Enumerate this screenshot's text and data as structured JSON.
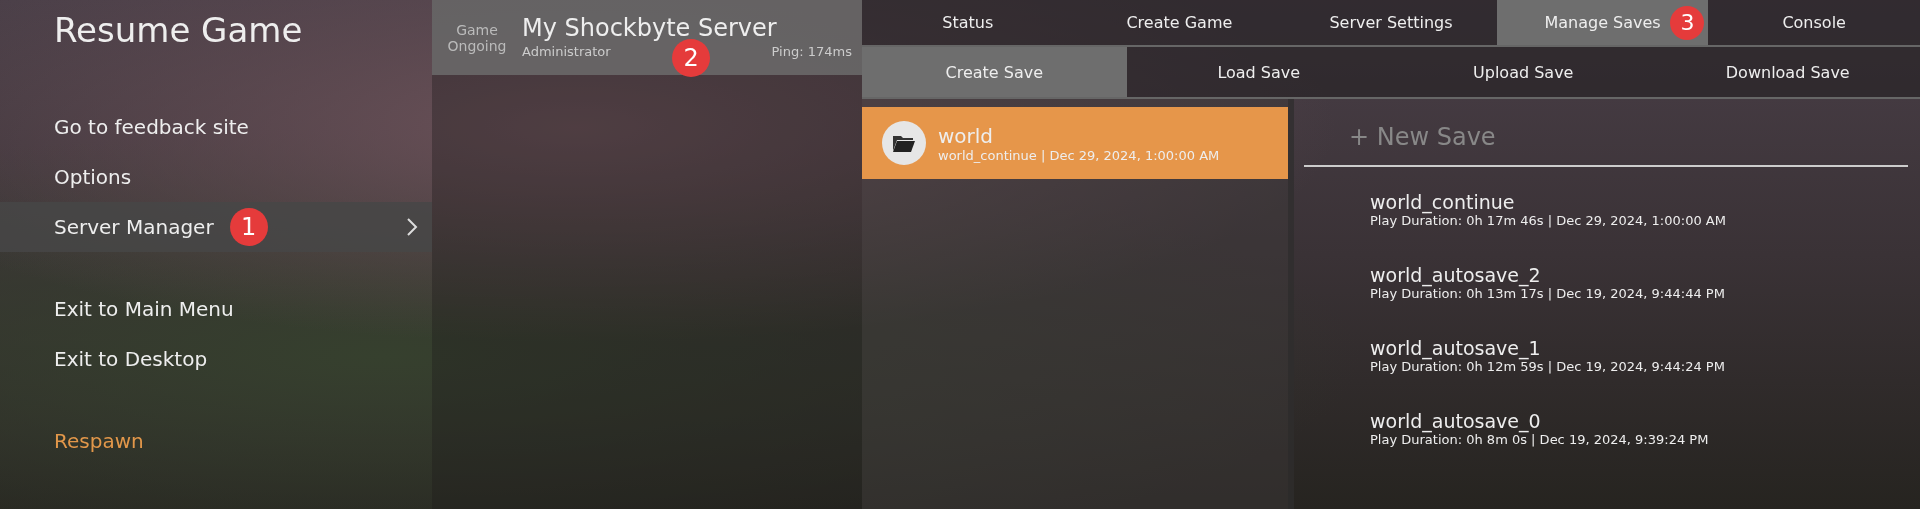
{
  "pause_menu": {
    "title": "Resume Game",
    "groups": [
      [
        {
          "label": "Go to feedback site",
          "selected": false,
          "kind": "plain"
        },
        {
          "label": "Options",
          "selected": false,
          "kind": "plain"
        },
        {
          "label": "Server Manager",
          "selected": true,
          "kind": "submenu",
          "marker": "1"
        }
      ],
      [
        {
          "label": "Exit to Main Menu",
          "selected": false,
          "kind": "plain"
        },
        {
          "label": "Exit to Desktop",
          "selected": false,
          "kind": "plain"
        }
      ],
      [
        {
          "label": "Respawn",
          "selected": false,
          "kind": "accent"
        }
      ]
    ]
  },
  "server": {
    "status_line_1": "Game",
    "status_line_2": "Ongoing",
    "name": "My Shockbyte Server",
    "role": "Administrator",
    "ping": "Ping: 174ms",
    "marker": "2"
  },
  "tabs": [
    {
      "label": "Status",
      "selected": false
    },
    {
      "label": "Create Game",
      "selected": false
    },
    {
      "label": "Server Settings",
      "selected": false
    },
    {
      "label": "Manage Saves",
      "selected": true,
      "marker": "3"
    },
    {
      "label": "Console",
      "selected": false
    }
  ],
  "sub_tabs": [
    {
      "label": "Create Save",
      "selected": true
    },
    {
      "label": "Load Save",
      "selected": false
    },
    {
      "label": "Upload Save",
      "selected": false
    },
    {
      "label": "Download Save",
      "selected": false
    }
  ],
  "worlds": [
    {
      "name": "world",
      "detail": "world_continue | Dec 29, 2024, 1:00:00 AM",
      "selected": true
    }
  ],
  "new_save": "+ New Save",
  "saves": [
    {
      "name": "world_continue",
      "detail": "Play Duration: 0h 17m 46s | Dec 29, 2024, 1:00:00 AM"
    },
    {
      "name": "world_autosave_2",
      "detail": "Play Duration: 0h 13m 17s | Dec 19, 2024, 9:44:44 PM"
    },
    {
      "name": "world_autosave_1",
      "detail": "Play Duration: 0h 12m 59s | Dec 19, 2024, 9:44:24 PM"
    },
    {
      "name": "world_autosave_0",
      "detail": "Play Duration: 0h 8m 0s | Dec 19, 2024, 9:39:24 PM"
    }
  ]
}
